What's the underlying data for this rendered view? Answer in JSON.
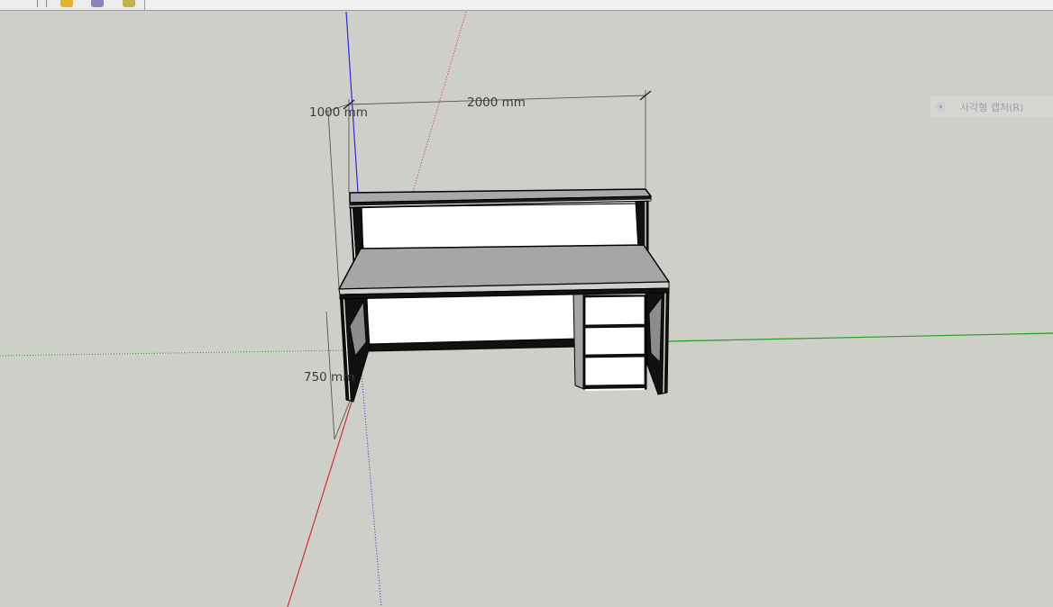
{
  "toolbar": {
    "tools": [
      {
        "name": "select-icon",
        "color": "#e2b22a"
      },
      {
        "name": "paint-bucket-icon",
        "color": "#8a83b8"
      },
      {
        "name": "eraser-icon",
        "color": "#c4b24a"
      }
    ]
  },
  "viewport": {
    "background": "#cfcfca",
    "axes": {
      "red": "#d0312d",
      "green": "#22a022",
      "blue": "#2b2bd6"
    }
  },
  "dimensions": {
    "width_label": "2000 mm",
    "total_height_label": "1000 mm",
    "desk_height_label": "750 mm"
  },
  "overlay": {
    "capture_hint": "사각형 캡처(R)"
  }
}
